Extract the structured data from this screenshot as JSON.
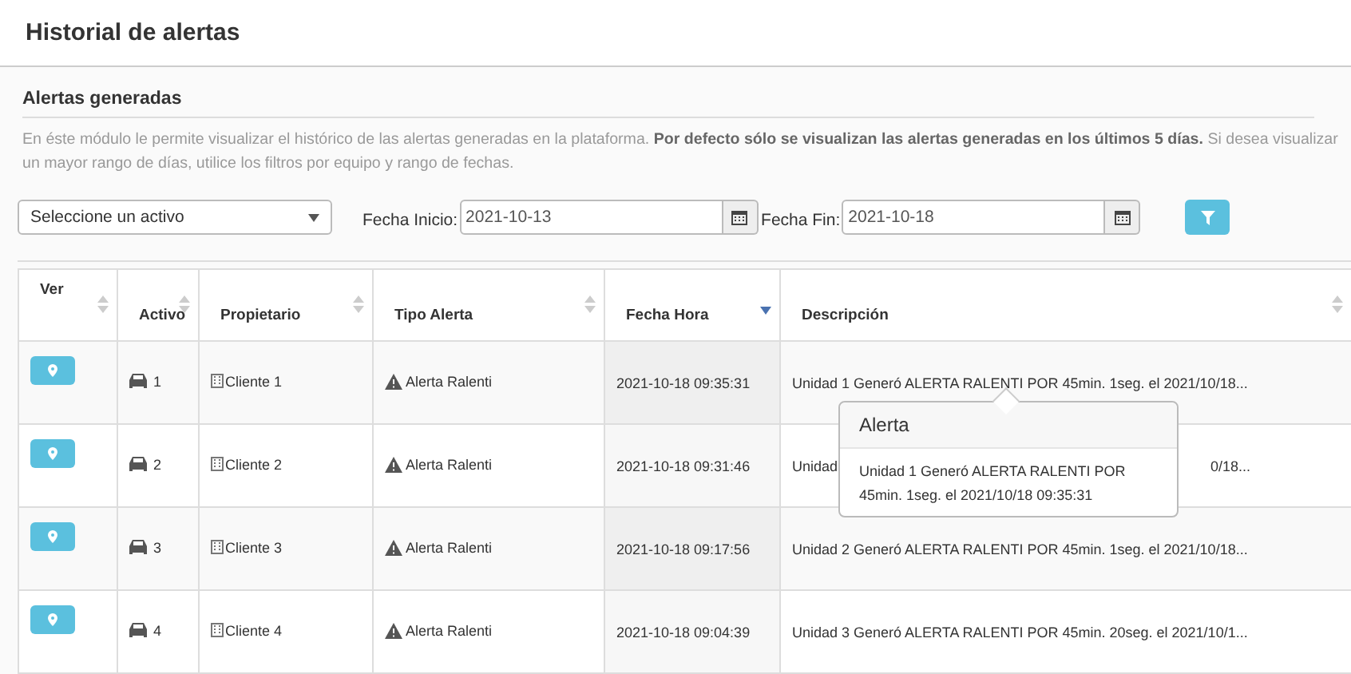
{
  "page": {
    "title": "Historial de alertas"
  },
  "section": {
    "title": "Alertas generadas",
    "description": "En éste módulo le permite visualizar el histórico de las alertas generadas en la plataforma. **Por defecto sólo se visualizan las alertas generadas en los últimos 5 días.** Si desea visualizar un mayor rango de días, utilice los filtros por equipo y rango de fechas."
  },
  "filters": {
    "asset_select": {
      "value": "Seleccione un activo"
    },
    "start_label": "Fecha Inicio:",
    "start_value": "2021-10-13",
    "end_label": "Fecha Fin:",
    "end_value": "2021-10-18"
  },
  "table": {
    "columns": [
      {
        "label": "Ver",
        "sorted": false
      },
      {
        "label": "Activo",
        "sorted": false
      },
      {
        "label": "Propietario",
        "sorted": false
      },
      {
        "label": "Tipo Alerta",
        "sorted": false
      },
      {
        "label": "Fecha Hora",
        "sorted": true
      },
      {
        "label": "Descripción",
        "sorted": false
      }
    ],
    "rows": [
      {
        "asset": "1",
        "owner": "Cliente 1",
        "type": "Alerta Ralenti",
        "datetime": "2021-10-18 09:35:31",
        "description": [
          "Unidad 1 Generó ALERTA RALENTI POR 45min. 1seg. el 2021/10/18..."
        ]
      },
      {
        "asset": "2",
        "owner": "Cliente 2",
        "type": "Alerta Ralenti",
        "datetime": "2021-10-18 09:31:46",
        "description": [
          "Unidad",
          "0/18..."
        ]
      },
      {
        "asset": "3",
        "owner": "Cliente 3",
        "type": "Alerta Ralenti",
        "datetime": "2021-10-18 09:17:56",
        "description": [
          "Unidad 2 Generó ALERTA RALENTI POR 45min. 1seg. el 2021/10/18..."
        ]
      },
      {
        "asset": "4",
        "owner": "Cliente 4",
        "type": "Alerta Ralenti",
        "datetime": "2021-10-18 09:04:39",
        "description": [
          "Unidad 3 Generó ALERTA RALENTI POR 45min. 20seg. el 2021/10/1..."
        ]
      }
    ]
  },
  "popover": {
    "title": "Alerta",
    "body": "Unidad 1 Generó ALERTA RALENTI POR 45min. 1seg. el 2021/10/18 09:35:31"
  }
}
